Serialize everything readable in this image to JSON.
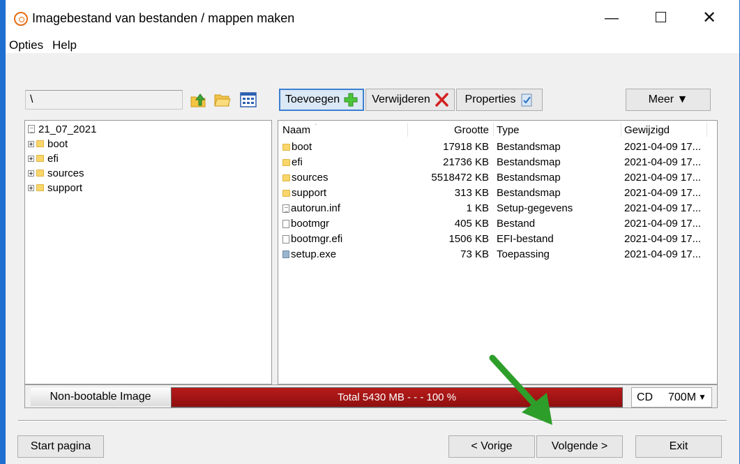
{
  "window": {
    "title": "Imagebestand van bestanden / mappen maken",
    "minimize": "—",
    "close": "✕"
  },
  "menu": [
    "Opties",
    "Help"
  ],
  "path": {
    "value": "\\"
  },
  "toolbar": {
    "add": "Toevoegen",
    "remove": "Verwijderen",
    "properties": "Properties",
    "more": "Meer ▼"
  },
  "tree": {
    "root": "21_07_2021",
    "items": [
      "boot",
      "efi",
      "sources",
      "support"
    ]
  },
  "list": {
    "columns": {
      "name": "Naam",
      "size": "Grootte",
      "type": "Type",
      "modified": "Gewijzigd"
    },
    "rows": [
      {
        "name": "boot",
        "size": "17918 KB",
        "type": "Bestandsmap",
        "modified": "2021-04-09 17...",
        "icon": "folder"
      },
      {
        "name": "efi",
        "size": "21736 KB",
        "type": "Bestandsmap",
        "modified": "2021-04-09 17...",
        "icon": "folder"
      },
      {
        "name": "sources",
        "size": "5518472 KB",
        "type": "Bestandsmap",
        "modified": "2021-04-09 17...",
        "icon": "folder"
      },
      {
        "name": "support",
        "size": "313 KB",
        "type": "Bestandsmap",
        "modified": "2021-04-09 17...",
        "icon": "folder"
      },
      {
        "name": "autorun.inf",
        "size": "1 KB",
        "type": "Setup-gegevens",
        "modified": "2021-04-09 17...",
        "icon": "settings-file"
      },
      {
        "name": "bootmgr",
        "size": "405 KB",
        "type": "Bestand",
        "modified": "2021-04-09 17...",
        "icon": "file"
      },
      {
        "name": "bootmgr.efi",
        "size": "1506 KB",
        "type": "EFI-bestand",
        "modified": "2021-04-09 17...",
        "icon": "file"
      },
      {
        "name": "setup.exe",
        "size": "73 KB",
        "type": "Toepassing",
        "modified": "2021-04-09 17...",
        "icon": "application"
      }
    ]
  },
  "status": {
    "boot": "Non-bootable Image",
    "progress_text": "Total  5430 MB   - - -   100 %",
    "progress_fraction": 1.0,
    "media": "CD",
    "capacity": "700M",
    "dropdown_arrow": "▼"
  },
  "footer": {
    "start": "Start pagina",
    "prev": "< Vorige",
    "next": "Volgende >",
    "exit": "Exit"
  },
  "colors": {
    "progress_fill": "#a11414",
    "annotation_arrow": "#2e9e2a",
    "title_bar_border": "#1f6fd0"
  }
}
